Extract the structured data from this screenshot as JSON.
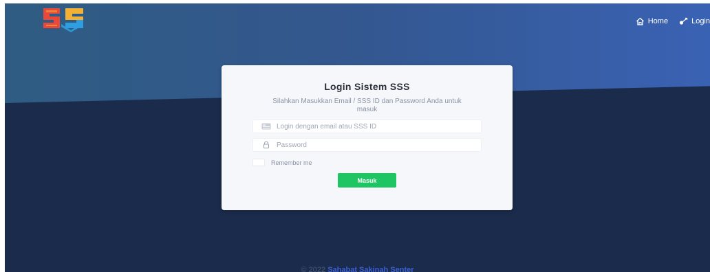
{
  "header": {
    "logo": {
      "text": "SSS",
      "colors": [
        "#e8493b",
        "#f2b134",
        "#2f9ee0"
      ]
    },
    "nav": [
      {
        "label": "Home",
        "icon": "home-icon"
      },
      {
        "label": "Login",
        "icon": "login-icon"
      }
    ]
  },
  "login": {
    "title": "Login Sistem SSS",
    "subtitle": "Silahkan Masukkan Email / SSS ID dan Password Anda untuk masuk",
    "email": {
      "placeholder": "Login dengan email atau SSS ID",
      "value": "",
      "icon": "id-card-icon"
    },
    "password": {
      "placeholder": "Password",
      "value": "",
      "icon": "lock-icon"
    },
    "remember_label": "Remember me",
    "remember_checked": false,
    "submit_label": "Masuk"
  },
  "footer": {
    "copyright": "© 2022",
    "brand": "Sahabat Sakinah Senter"
  },
  "colors": {
    "accent": "#1fc463",
    "background": "#1b2b4b",
    "hero": "#33578f",
    "brand_link": "#3b5fcf"
  }
}
